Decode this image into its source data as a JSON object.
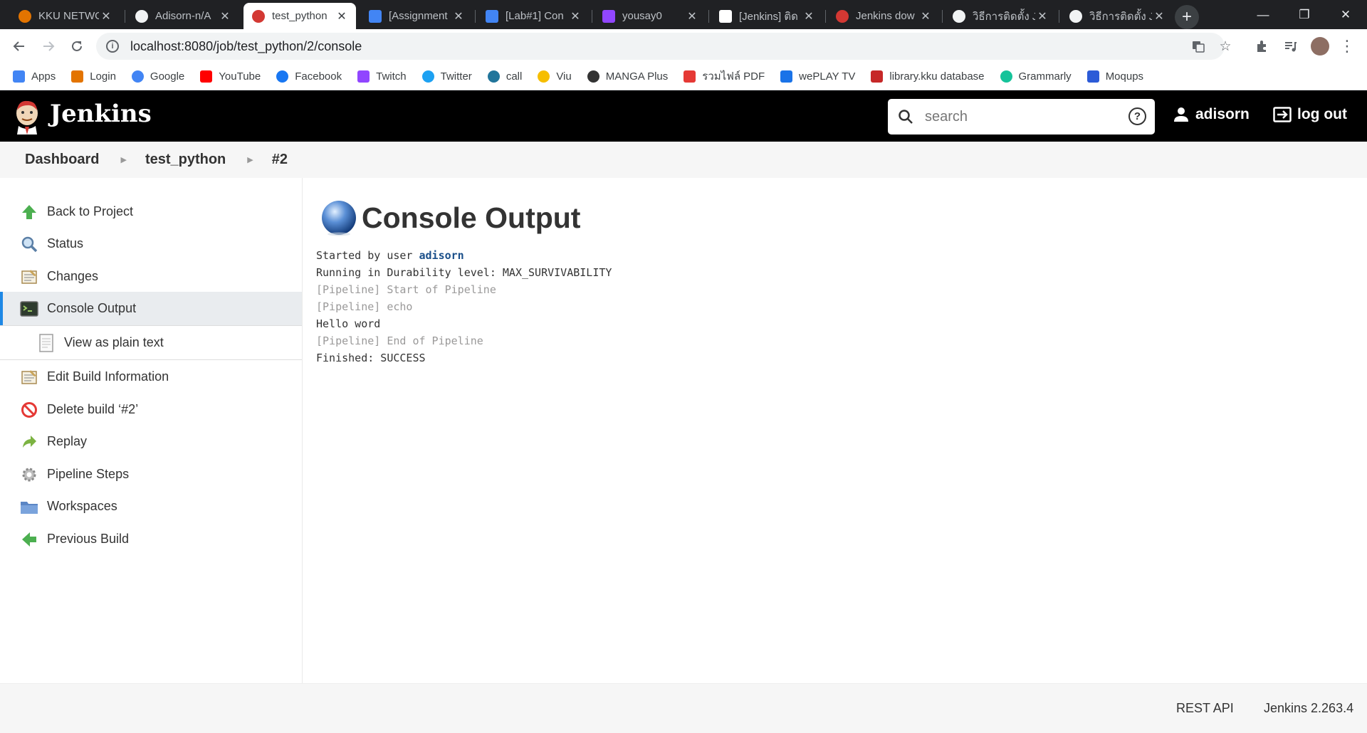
{
  "browser": {
    "tabs": [
      {
        "label": "KKU NETWO",
        "favicon_color": "#e37400"
      },
      {
        "label": "Adisorn-n/A",
        "favicon_color": "#f1f3f4"
      },
      {
        "label": "test_python",
        "favicon_color": "#d33833",
        "active": true
      },
      {
        "label": "[Assignment",
        "favicon_color": "#4285f4"
      },
      {
        "label": "[Lab#1] Con",
        "favicon_color": "#4285f4"
      },
      {
        "label": "yousay0",
        "favicon_color": "#9146ff"
      },
      {
        "label": "[Jenkins] ติด",
        "favicon_color": "#ffffff"
      },
      {
        "label": "Jenkins dow",
        "favicon_color": "#d33833"
      },
      {
        "label": "วิธีการติดตั้ง J",
        "favicon_color": "#f1f3f4"
      },
      {
        "label": "วิธีการติดตั้ง Je",
        "favicon_color": "#f1f3f4"
      }
    ],
    "new_tab": "+",
    "window_controls": {
      "minimize": "—",
      "maximize": "❐",
      "close": "✕"
    },
    "url": "localhost:8080/job/test_python/2/console",
    "bookmarks": [
      {
        "label": "Apps",
        "icon_color": "#4285f4"
      },
      {
        "label": "Login",
        "icon_color": "#e37400"
      },
      {
        "label": "Google",
        "icon_color": "#4285f4"
      },
      {
        "label": "YouTube",
        "icon_color": "#ff0000"
      },
      {
        "label": "Facebook",
        "icon_color": "#1877f2"
      },
      {
        "label": "Twitch",
        "icon_color": "#9146ff"
      },
      {
        "label": "Twitter",
        "icon_color": "#1da1f2"
      },
      {
        "label": "call",
        "icon_color": "#21759b"
      },
      {
        "label": "Viu",
        "icon_color": "#f6be00"
      },
      {
        "label": "MANGA Plus",
        "icon_color": "#333333"
      },
      {
        "label": "รวมไฟล์ PDF",
        "icon_color": "#e53935"
      },
      {
        "label": "wePLAY TV",
        "icon_color": "#1a73e8"
      },
      {
        "label": "library.kku database",
        "icon_color": "#c62828"
      },
      {
        "label": "Grammarly",
        "icon_color": "#15c39a"
      },
      {
        "label": "Moqups",
        "icon_color": "#2c5bd7"
      }
    ]
  },
  "jenkins": {
    "title": "Jenkins",
    "search_placeholder": "search",
    "help": "?",
    "user": "adisorn",
    "logout": "log out",
    "breadcrumb": [
      "Dashboard",
      "test_python",
      "#2"
    ],
    "sidebar": [
      {
        "label": "Back to Project",
        "icon": "arrow-up-icon",
        "color": "#4caf50"
      },
      {
        "label": "Status",
        "icon": "magnifier-icon",
        "color": "#5b7fa6"
      },
      {
        "label": "Changes",
        "icon": "notepad-icon",
        "color": "#c9a45a"
      },
      {
        "label": "Console Output",
        "icon": "terminal-icon",
        "color": "#2e3b2e",
        "active": true
      },
      {
        "label": "View as plain text",
        "icon": "document-icon",
        "color": "#9e9e9e",
        "sub": true
      },
      {
        "label": "Edit Build Information",
        "icon": "notepad-icon",
        "color": "#c9a45a"
      },
      {
        "label": "Delete build ‘#2’",
        "icon": "no-entry-icon",
        "color": "#e53935"
      },
      {
        "label": "Replay",
        "icon": "replay-arrow-icon",
        "color": "#7cb342"
      },
      {
        "label": "Pipeline Steps",
        "icon": "gear-icon",
        "color": "#9e9e9e"
      },
      {
        "label": "Workspaces",
        "icon": "folder-icon",
        "color": "#5b86c5"
      },
      {
        "label": "Previous Build",
        "icon": "arrow-left-icon",
        "color": "#4caf50"
      }
    ],
    "console": {
      "heading": "Console Output",
      "started_prefix": "Started by user ",
      "started_user": "adisorn",
      "line_durability": "Running in Durability level: MAX_SURVIVABILITY",
      "line_start_pipeline": "[Pipeline] Start of Pipeline",
      "line_echo": "[Pipeline] echo",
      "line_hello": "Hello word",
      "line_end_pipeline": "[Pipeline] End of Pipeline",
      "line_finished": "Finished: SUCCESS"
    },
    "footer": {
      "rest_api": "REST API",
      "version": "Jenkins 2.263.4"
    }
  }
}
